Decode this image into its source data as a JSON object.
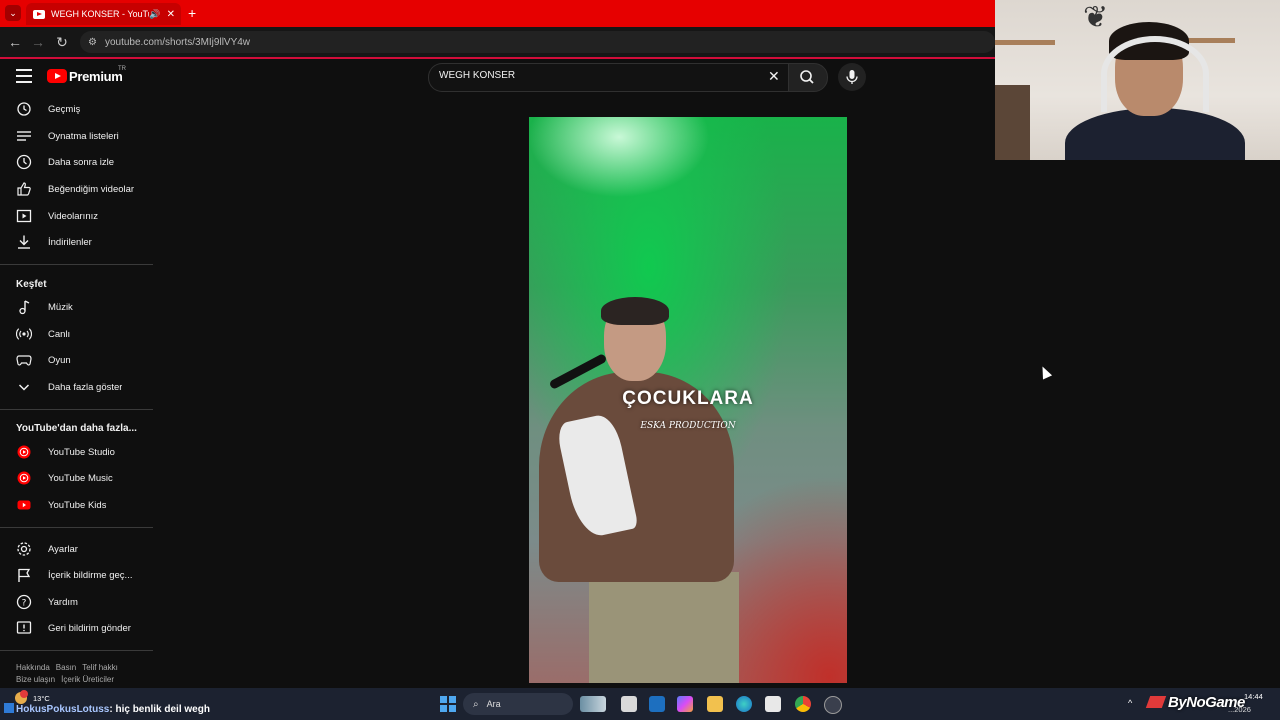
{
  "browser": {
    "tab_title": "WEGH KONSER - YouTube",
    "url": "youtube.com/shorts/3MIj9llVY4w",
    "new_tab_glyph": "+",
    "close_glyph": "✕"
  },
  "youtube": {
    "logo_text": "Premium",
    "region": "TR",
    "search_query": "WEGH KONSER",
    "sidebar_you": [
      {
        "label": "Geçmiş",
        "icon": "history-icon"
      },
      {
        "label": "Oynatma listeleri",
        "icon": "playlists-icon"
      },
      {
        "label": "Daha sonra izle",
        "icon": "watch-later-icon"
      },
      {
        "label": "Beğendiğim videolar",
        "icon": "like-icon"
      },
      {
        "label": "Videolarınız",
        "icon": "your-videos-icon"
      },
      {
        "label": "İndirilenler",
        "icon": "download-icon"
      }
    ],
    "explore_heading": "Keşfet",
    "sidebar_explore": [
      {
        "label": "Müzik",
        "icon": "music-icon"
      },
      {
        "label": "Canlı",
        "icon": "live-icon"
      },
      {
        "label": "Oyun",
        "icon": "gaming-icon"
      },
      {
        "label": "Daha fazla göster",
        "icon": "chevron-down-icon"
      }
    ],
    "more_heading": "YouTube'dan daha fazla...",
    "sidebar_more": [
      {
        "label": "YouTube Studio",
        "icon": "youtube-studio-icon"
      },
      {
        "label": "YouTube Music",
        "icon": "youtube-music-icon"
      },
      {
        "label": "YouTube Kids",
        "icon": "youtube-kids-icon"
      }
    ],
    "sidebar_settings": [
      {
        "label": "Ayarlar",
        "icon": "settings-icon"
      },
      {
        "label": "İçerik bildirme geç...",
        "icon": "flag-icon"
      },
      {
        "label": "Yardım",
        "icon": "help-icon"
      },
      {
        "label": "Geri bildirim gönder",
        "icon": "feedback-icon"
      }
    ],
    "footer_row1": [
      "Hakkında",
      "Basın",
      "Telif hakkı"
    ],
    "footer_row2": [
      "Bize ulaşın",
      "İçerik Üreticiler"
    ],
    "short": {
      "caption": "ÇOCUKLARA",
      "watermark": "ESKA PRODUCTION"
    }
  },
  "taskbar": {
    "weather_temp": "13°C",
    "weather_badge": "1",
    "chat_user": "HokusPokusLotuss",
    "chat_message": ": hiç benlik deil wegh",
    "search_label": "Ara",
    "brand_overlay": "ByNoGame",
    "clock_time": "14:44",
    "clock_date": "...2026"
  },
  "colors": {
    "youtube_red": "#ff0000",
    "browser_tab_bar": "#e60000",
    "background": "#0f0f0f"
  }
}
